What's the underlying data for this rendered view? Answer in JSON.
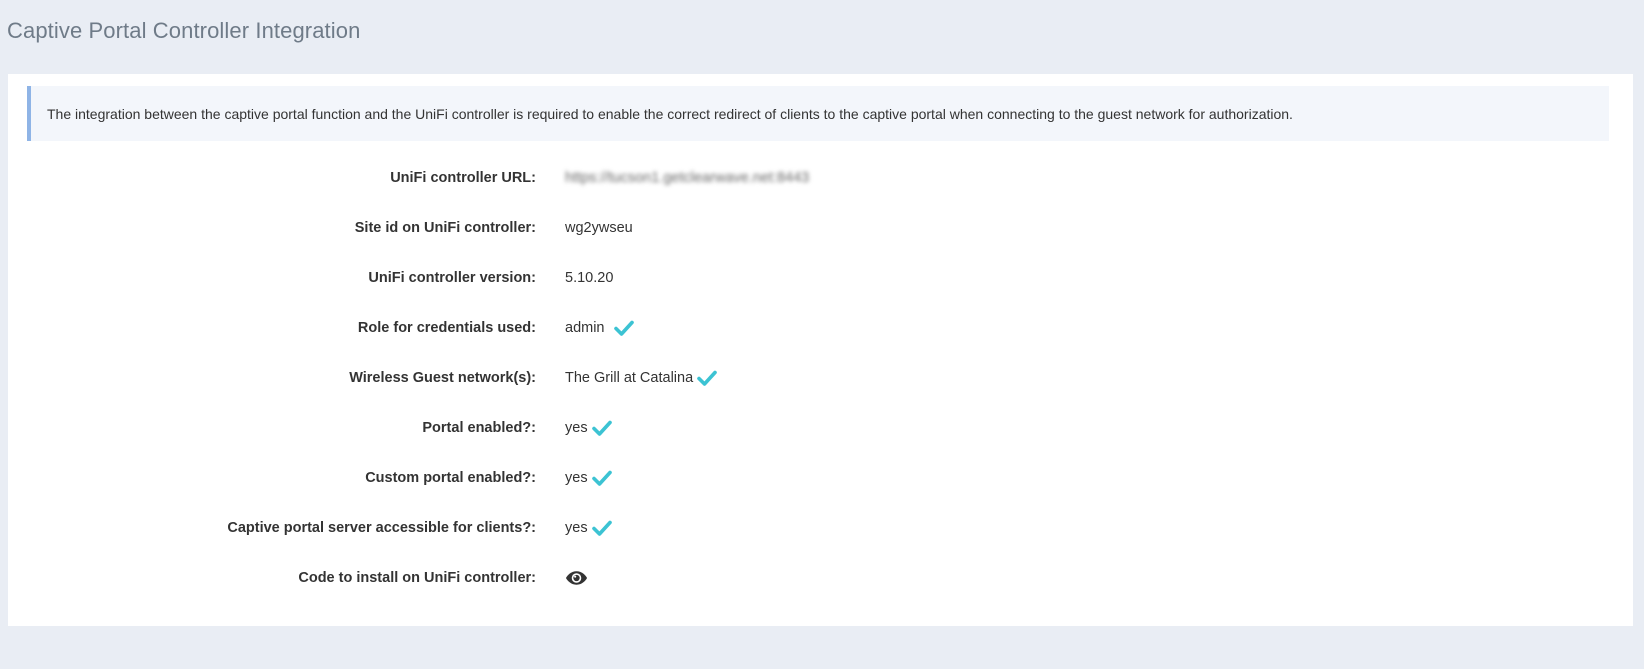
{
  "page": {
    "title": "Captive Portal Controller Integration"
  },
  "info": {
    "text": "The integration between the captive portal function and the UniFi controller is required to enable the correct redirect of clients to the captive portal when connecting to the guest network for authorization."
  },
  "fields": {
    "controller_url": {
      "label": "UniFi controller URL:",
      "value": "https://tucson1.getclearwave.net:8443"
    },
    "site_id": {
      "label": "Site id on UniFi controller:",
      "value": "wg2ywseu"
    },
    "controller_version": {
      "label": "UniFi controller version:",
      "value": "5.10.20"
    },
    "credentials_role": {
      "label": "Role for credentials used:",
      "value": "admin",
      "status": "check-icon"
    },
    "guest_networks": {
      "label": "Wireless Guest network(s):",
      "value": "The Grill at Catalina",
      "status": "check-icon"
    },
    "portal_enabled": {
      "label": "Portal enabled?:",
      "value": "yes",
      "status": "check-icon"
    },
    "custom_portal_enabled": {
      "label": "Custom portal enabled?:",
      "value": "yes",
      "status": "check-icon"
    },
    "server_accessible": {
      "label": "Captive portal server accessible for clients?:",
      "value": "yes",
      "status": "check-icon"
    },
    "install_code": {
      "label": "Code to install on UniFi controller:",
      "action": "eye-icon"
    }
  },
  "colors": {
    "background": "#e9edf4",
    "panel": "#ffffff",
    "info_border": "#8fb4e6",
    "check": "#3cc3d3",
    "title": "#6f7b88"
  }
}
